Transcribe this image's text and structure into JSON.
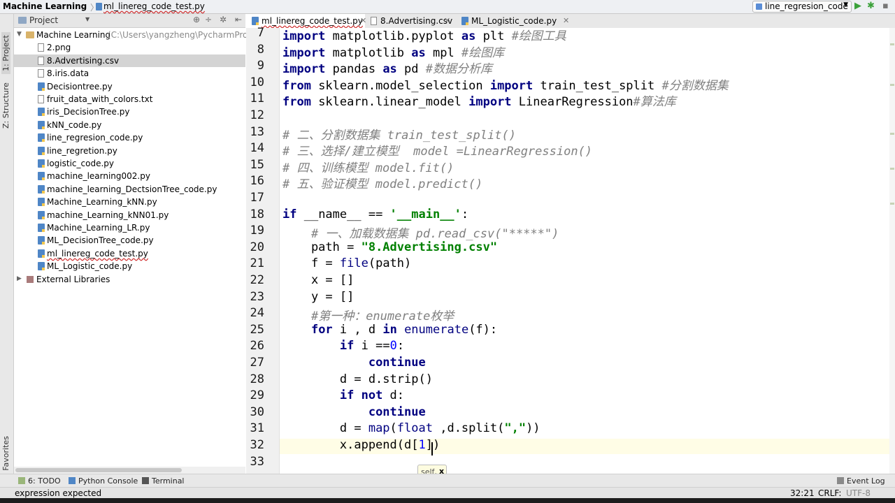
{
  "navbar": {
    "project": "Machine Learning",
    "separator": "〉",
    "file": "ml_linereg_code_test.py",
    "run_config": "line_regresion_code",
    "run_icon": "▶",
    "debug_icon": "✱",
    "more_icon": "▪"
  },
  "left_strip": {
    "project_tab": "1: Project",
    "structure_tab": "Z: Structure",
    "favorites_tab": "2: Favorites"
  },
  "project_panel": {
    "title": "Project",
    "root_name": "Machine Learning",
    "root_path": "(C:\\Users\\yangzheng\\PycharmProje",
    "files": [
      {
        "name": "2.png",
        "kind": "file"
      },
      {
        "name": "8.Advertising.csv",
        "kind": "file",
        "selected": true
      },
      {
        "name": "8.iris.data",
        "kind": "file"
      },
      {
        "name": "Decisiontree.py",
        "kind": "py"
      },
      {
        "name": "fruit_data_with_colors.txt",
        "kind": "file"
      },
      {
        "name": "iris_DecisionTree.py",
        "kind": "py"
      },
      {
        "name": "kNN_code.py",
        "kind": "py"
      },
      {
        "name": "line_regresion_code.py",
        "kind": "py"
      },
      {
        "name": "line_regretion.py",
        "kind": "py"
      },
      {
        "name": "logistic_code.py",
        "kind": "py"
      },
      {
        "name": "machine_learning002.py",
        "kind": "py"
      },
      {
        "name": "machine_learning_DectsionTree_code.py",
        "kind": "py"
      },
      {
        "name": "Machine_Learning_kNN.py",
        "kind": "py"
      },
      {
        "name": "machine_Learning_kNN01.py",
        "kind": "py"
      },
      {
        "name": "Machine_Learning_LR.py",
        "kind": "py"
      },
      {
        "name": "ML_DecisionTree_code.py",
        "kind": "py"
      },
      {
        "name": "ml_linereg_code_test.py",
        "kind": "py",
        "error": true
      },
      {
        "name": "ML_Logistic_code.py",
        "kind": "py"
      }
    ],
    "external": "External Libraries"
  },
  "tabs": [
    {
      "label": "ml_linereg_code_test.py",
      "active": true
    },
    {
      "label": "8.Advertising.csv",
      "active": false
    },
    {
      "label": "ML_Logistic_code.py",
      "active": false
    }
  ],
  "code_lines": [
    {
      "n": "7",
      "html": "<span class=\"kw\">import</span> matplotlib.pyplot <span class=\"kw\">as</span> plt <span class=\"cm\">#绘图工具</span>"
    },
    {
      "n": "8",
      "html": "<span class=\"kw\">import</span> matplotlib <span class=\"kw\">as</span> mpl <span class=\"cm\">#绘图库</span>"
    },
    {
      "n": "9",
      "html": "<span class=\"kw\">import</span> pandas <span class=\"kw\">as</span> pd <span class=\"cm\">#数据分析库</span>"
    },
    {
      "n": "10",
      "html": "<span class=\"kw\">from</span> sklearn.model_selection <span class=\"kw\">import</span> train_test_split <span class=\"cm\">#分割数据集</span>"
    },
    {
      "n": "11",
      "html": "<span class=\"kw\">from</span> sklearn.linear_model <span class=\"kw\">import</span> LinearRegression<span class=\"cm\">#算法库</span>"
    },
    {
      "n": "12",
      "html": ""
    },
    {
      "n": "13",
      "html": "<span class=\"cm\"># 二、分割数据集 train_test_split()</span>"
    },
    {
      "n": "14",
      "html": "<span class=\"cm\"># 三、选择/建立模型  model =LinearRegression()</span>"
    },
    {
      "n": "15",
      "html": "<span class=\"cm\"># 四、训练模型 model.fit()</span>"
    },
    {
      "n": "16",
      "html": "<span class=\"cm\"># 五、验证模型 model.predict()</span>"
    },
    {
      "n": "17",
      "html": ""
    },
    {
      "n": "18",
      "html": "<span class=\"kw\">if</span> __name__ == <span class=\"st\">'__main__'</span>:"
    },
    {
      "n": "19",
      "html": "    <span class=\"cm\"># 一、加载数据集 pd.read_csv(\"*****\")</span>"
    },
    {
      "n": "20",
      "html": "    path = <span class=\"st\">\"8.Advertising.csv\"</span>"
    },
    {
      "n": "21",
      "html": "    f = <span class=\"bi\">file</span>(path)"
    },
    {
      "n": "22",
      "html": "    x = []"
    },
    {
      "n": "23",
      "html": "    y = []"
    },
    {
      "n": "24",
      "html": "    <span class=\"cm\">#第一种：enumerate枚举</span>"
    },
    {
      "n": "25",
      "html": "    <span class=\"kw\">for</span> i , d <span class=\"kw\">in</span> <span class=\"bi\">enumerate</span>(f):"
    },
    {
      "n": "26",
      "html": "        <span class=\"kw\">if</span> i ==<span class=\"num\">0</span>:"
    },
    {
      "n": "27",
      "html": "            <span class=\"kw\">continue</span>"
    },
    {
      "n": "28",
      "html": "        d = d.strip()"
    },
    {
      "n": "29",
      "html": "        <span class=\"kw\">if not</span> d:"
    },
    {
      "n": "30",
      "html": "            <span class=\"kw\">continue</span>"
    },
    {
      "n": "31",
      "html": "        d = <span class=\"bi\">map</span>(<span class=\"bi\">float</span> ,d.split(<span class=\"st\">\",\"</span>))"
    },
    {
      "n": "32",
      "html": "        x.append(d[<span class=\"num\">1</span>])",
      "current": true
    },
    {
      "n": "33",
      "html": ""
    }
  ],
  "tooltip": {
    "text": "self,",
    "bold": "x"
  },
  "bottom_tools": {
    "todo": "6: TODO",
    "console": "Python Console",
    "terminal": "Terminal",
    "event_log": "Event Log"
  },
  "status": {
    "message": "expression expected",
    "position": "32:21",
    "line_sep": "CRLF:",
    "encoding": "UTF-8"
  }
}
